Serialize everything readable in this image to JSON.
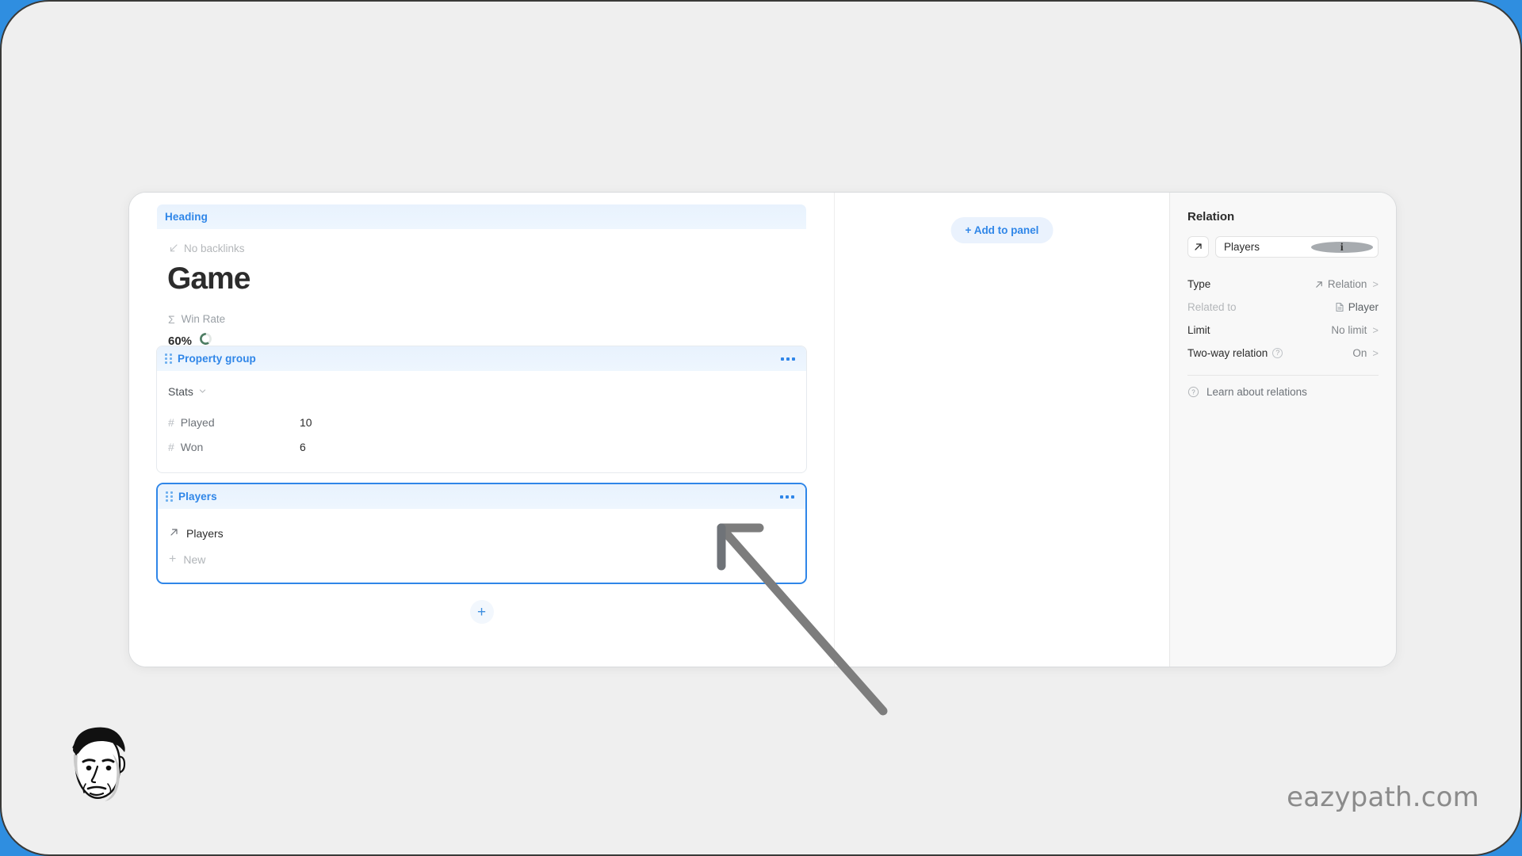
{
  "window": {
    "heading_block": {
      "bar_label": "Heading",
      "backlinks_text": "No backlinks",
      "title": "Game",
      "formula_label": "Win Rate",
      "win_rate_value": "60%",
      "win_rate_percent": 60,
      "ring_color": "#4d7d63"
    },
    "property_group_block": {
      "bar_label": "Property group",
      "group_name": "Stats",
      "rows": [
        {
          "icon": "hash-icon",
          "key": "Played",
          "value": "10"
        },
        {
          "icon": "hash-icon",
          "key": "Won",
          "value": "6"
        }
      ]
    },
    "players_block": {
      "bar_label": "Players",
      "selected": true,
      "relation_label": "Players",
      "new_label": "New"
    },
    "add_block_label": "+",
    "middle": {
      "add_to_panel_label": "+ Add to panel"
    },
    "right_panel": {
      "title": "Relation",
      "name_value": "Players",
      "name_icon": "relation-arrow-icon",
      "info_badge": "i",
      "rows": [
        {
          "label": "Type",
          "value": "Relation",
          "icon": "relation-arrow-icon",
          "chevron": ">",
          "muted_label": false
        },
        {
          "label": "Related to",
          "value": "Player",
          "icon": "document-icon",
          "chevron": "",
          "muted_label": true
        },
        {
          "label": "Limit",
          "value": "No limit",
          "icon": "",
          "chevron": ">",
          "muted_label": false
        },
        {
          "label": "Two-way relation",
          "value": "On",
          "icon": "",
          "chevron": ">",
          "muted_label": false,
          "help_badge": "?"
        }
      ],
      "learn_label": "Learn about relations",
      "learn_icon": "question-circle-icon"
    }
  },
  "watermark": "eazypath.com",
  "colors": {
    "accent_blue": "#2f86e8",
    "pill_bg": "#eaf2fd",
    "desktop_blue": "#2f8ee0",
    "screen_bg": "#efefef"
  }
}
